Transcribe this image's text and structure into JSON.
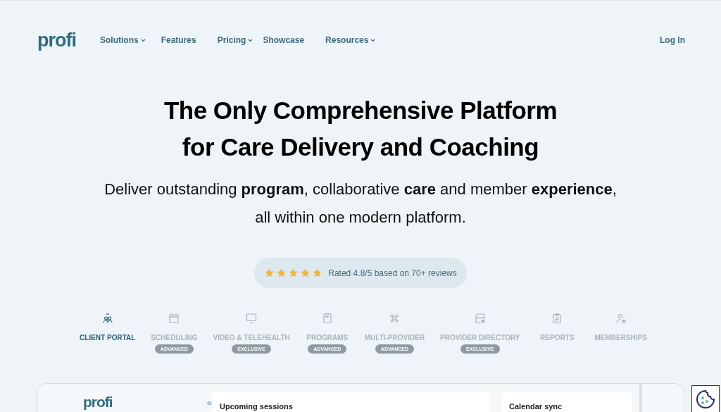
{
  "logo": "profi",
  "nav": [
    {
      "label": "Solutions",
      "dropdown": true
    },
    {
      "label": "Features",
      "dropdown": false
    },
    {
      "label": "Pricing",
      "dropdown": true
    },
    {
      "label": "Showcase",
      "dropdown": false
    },
    {
      "label": "Resources",
      "dropdown": true
    }
  ],
  "login": "Log In",
  "hero": {
    "title_lines": [
      "The Only Comprehensive Platform",
      "for Care Delivery and Coaching"
    ],
    "subtitle_lines": [
      "Deliver outstanding **program**, collaborative **care** and member **experience**,",
      "all within one modern platform."
    ]
  },
  "rating": {
    "stars": 5,
    "text": "Rated 4.8/5 based on 70+ reviews"
  },
  "tabs": [
    {
      "kind": "people",
      "label": "CLIENT PORTAL",
      "selected": true
    },
    {
      "kind": "calendar",
      "label": "SCHEDULING",
      "selected": false,
      "badge": "ADVANCED"
    },
    {
      "kind": "monitor",
      "label": "VIDEO & TELEHEALTH",
      "selected": false,
      "badge": "EXCLUSIVE"
    },
    {
      "kind": "book",
      "label": "PROGRAMS",
      "selected": false,
      "badge": "ADVANCED"
    },
    {
      "kind": "command",
      "label": "MULTI-PROVIDER",
      "selected": false,
      "badge": "ADVANCED"
    },
    {
      "kind": "store",
      "label": "PROVIDER DIRECTORY",
      "selected": false,
      "badge": "EXCLUSIVE"
    },
    {
      "kind": "clipboard",
      "label": "REPORTS",
      "selected": false
    },
    {
      "kind": "user-star",
      "label": "MEMBERSHIPS",
      "selected": false
    }
  ],
  "preview": {
    "logo": "profi",
    "collapse": "«",
    "cards": [
      "Upcoming sessions",
      "Calendar sync"
    ]
  }
}
